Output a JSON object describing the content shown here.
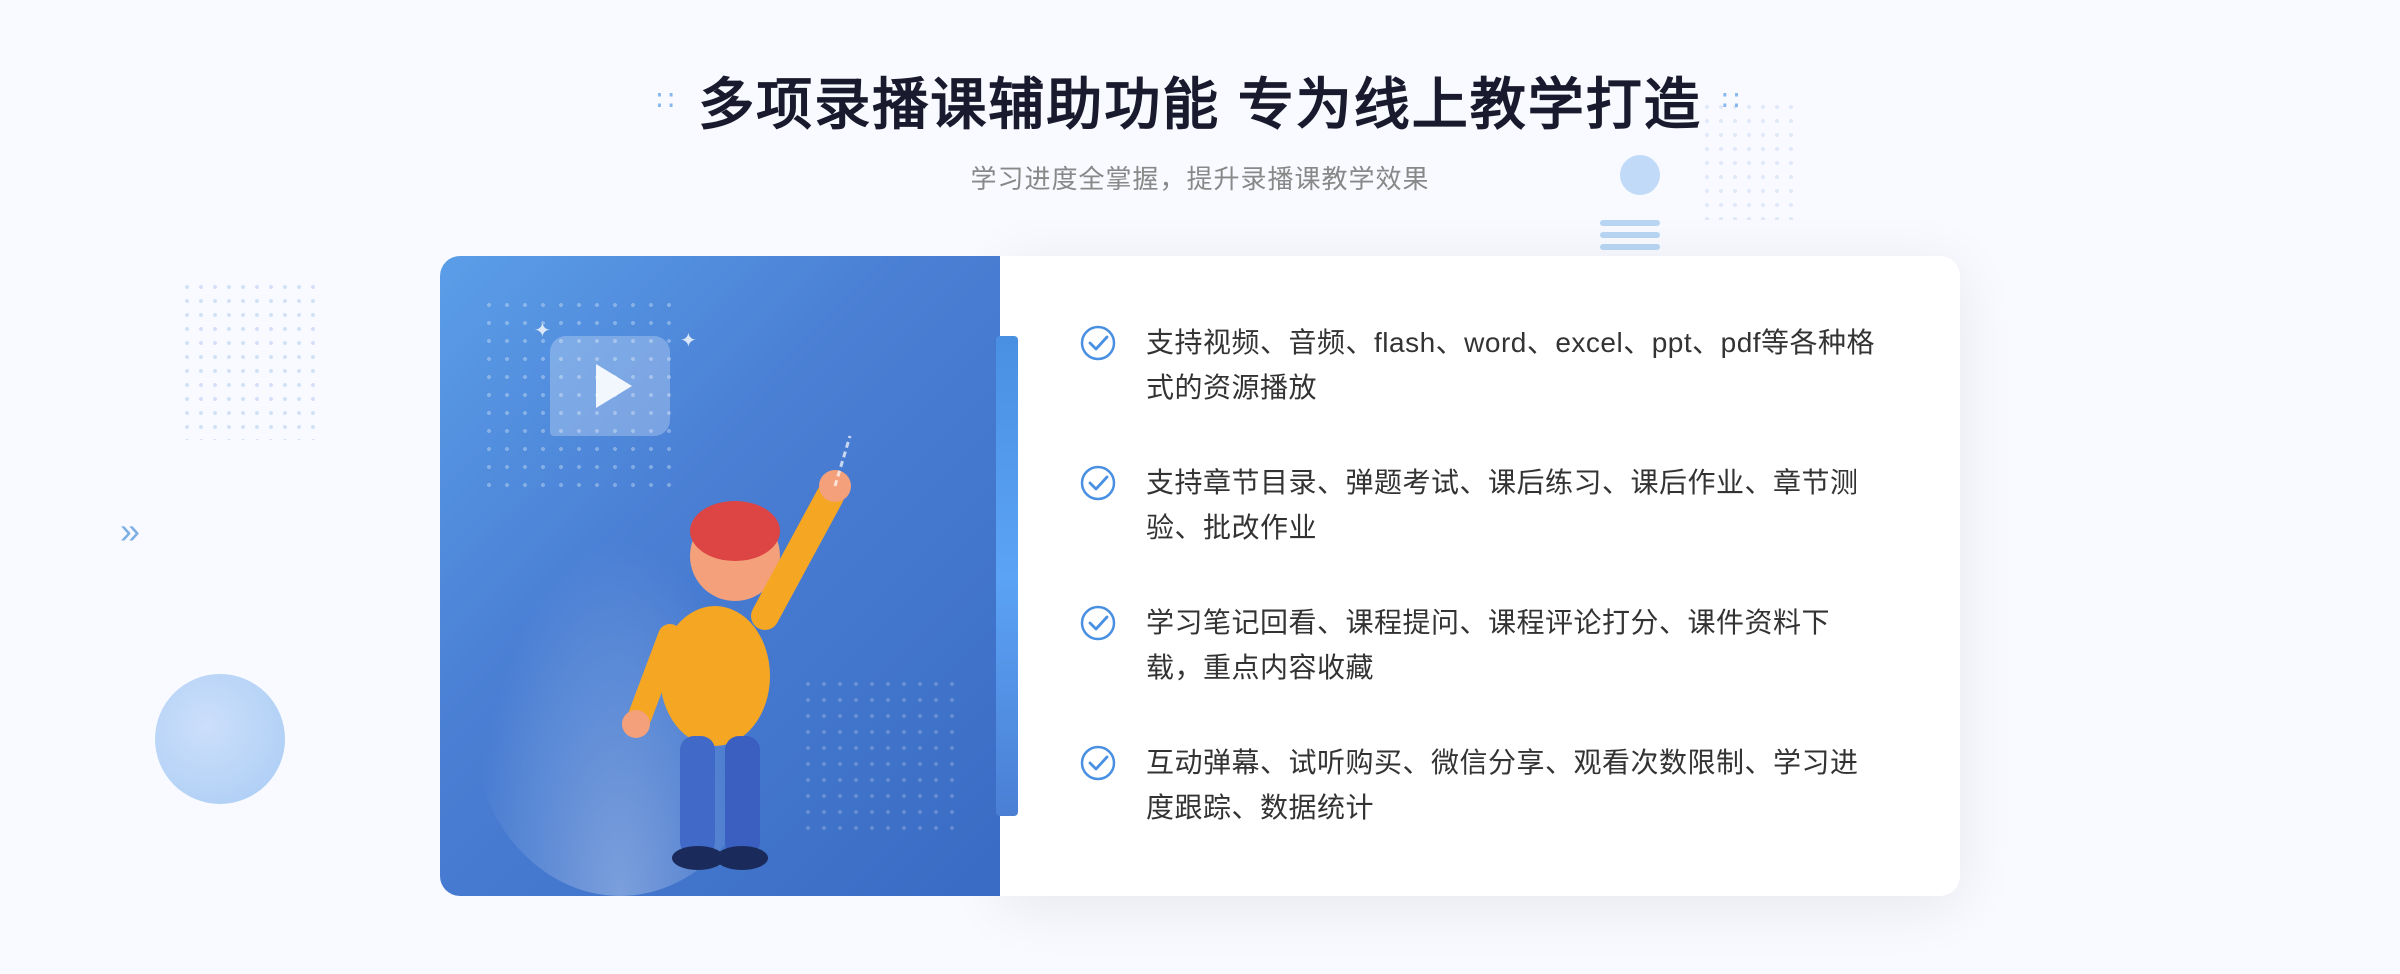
{
  "page": {
    "background": "#f8faff"
  },
  "header": {
    "title_dots_left": "∷",
    "title": "多项录播课辅助功能 专为线上教学打造",
    "title_dots_right": "∷",
    "subtitle": "学习进度全掌握，提升录播课教学效果"
  },
  "features": [
    {
      "id": "feature-1",
      "text": "支持视频、音频、flash、word、excel、ppt、pdf等各种格式的资源播放"
    },
    {
      "id": "feature-2",
      "text": "支持章节目录、弹题考试、课后练习、课后作业、章节测验、批改作业"
    },
    {
      "id": "feature-3",
      "text": "学习笔记回看、课程提问、课程评论打分、课件资料下载，重点内容收藏"
    },
    {
      "id": "feature-4",
      "text": "互动弹幕、试听购买、微信分享、观看次数限制、学习进度跟踪、数据统计"
    }
  ],
  "icons": {
    "check": "check-circle",
    "play": "play-triangle",
    "arrow": "»"
  }
}
